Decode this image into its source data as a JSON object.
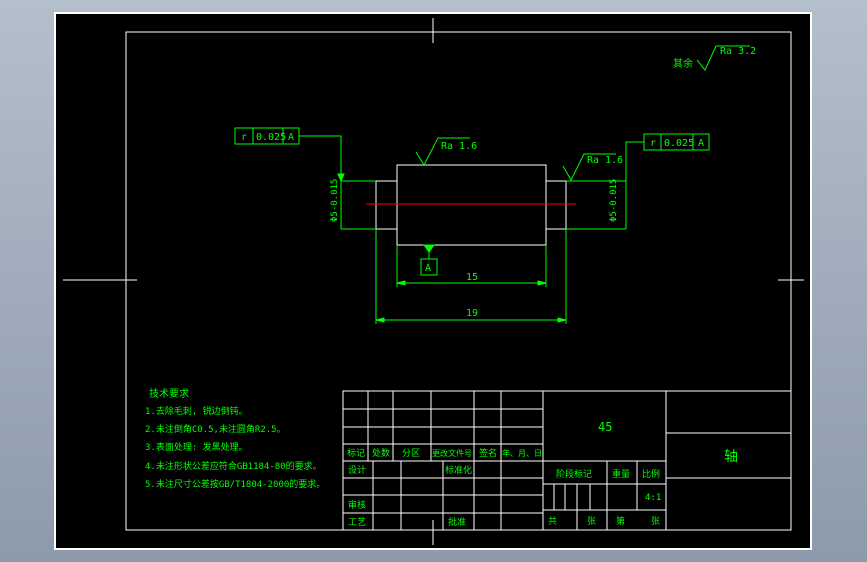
{
  "colors": {
    "background": "#000000",
    "frame": "#ffffff",
    "annotation": "#00ff00",
    "centerline": "#ff0000",
    "window": "#9aa7b7"
  },
  "roughness_note": {
    "prefix": "其余",
    "value": "Ra 3.2"
  },
  "tolerance_left": {
    "symbol": "r",
    "value": "0.025",
    "datum": "A"
  },
  "tolerance_right": {
    "symbol": "r",
    "value": "0.025",
    "datum": "A"
  },
  "roughness_middle": "Ra 1.6",
  "roughness_right": "Ra 1.6",
  "dia_left": "Φ5-0.015",
  "dia_right": "Φ5-0.015",
  "datum_label": "A",
  "dim_15": "15",
  "dim_19": "19",
  "tech_notes": {
    "title": "技术要求",
    "items": [
      "1.去除毛刺, 锐边倒钝。",
      "2.未注倒角C0.5,未注圆角R2.5。",
      "3.表面处理: 发黑处理。",
      "4.未注形状公差应符合GB1184-80的要求。",
      "5.未注尺寸公差按GB/T1804-2000的要求。"
    ]
  },
  "title_block": {
    "material": "45",
    "part_name": "轴",
    "scale_value": "4:1",
    "row_labels": [
      "标记",
      "处数",
      "分区",
      "更改文件号",
      "签名",
      "年、月、日"
    ],
    "design": "设计",
    "standardize": "标准化",
    "review": "审核",
    "process": "工艺",
    "approve": "批准",
    "stage_mark": "阶段标记",
    "weight": "重量",
    "scale": "比例",
    "total": "共",
    "sheets1": "张",
    "page": "第",
    "sheets2": "张"
  }
}
